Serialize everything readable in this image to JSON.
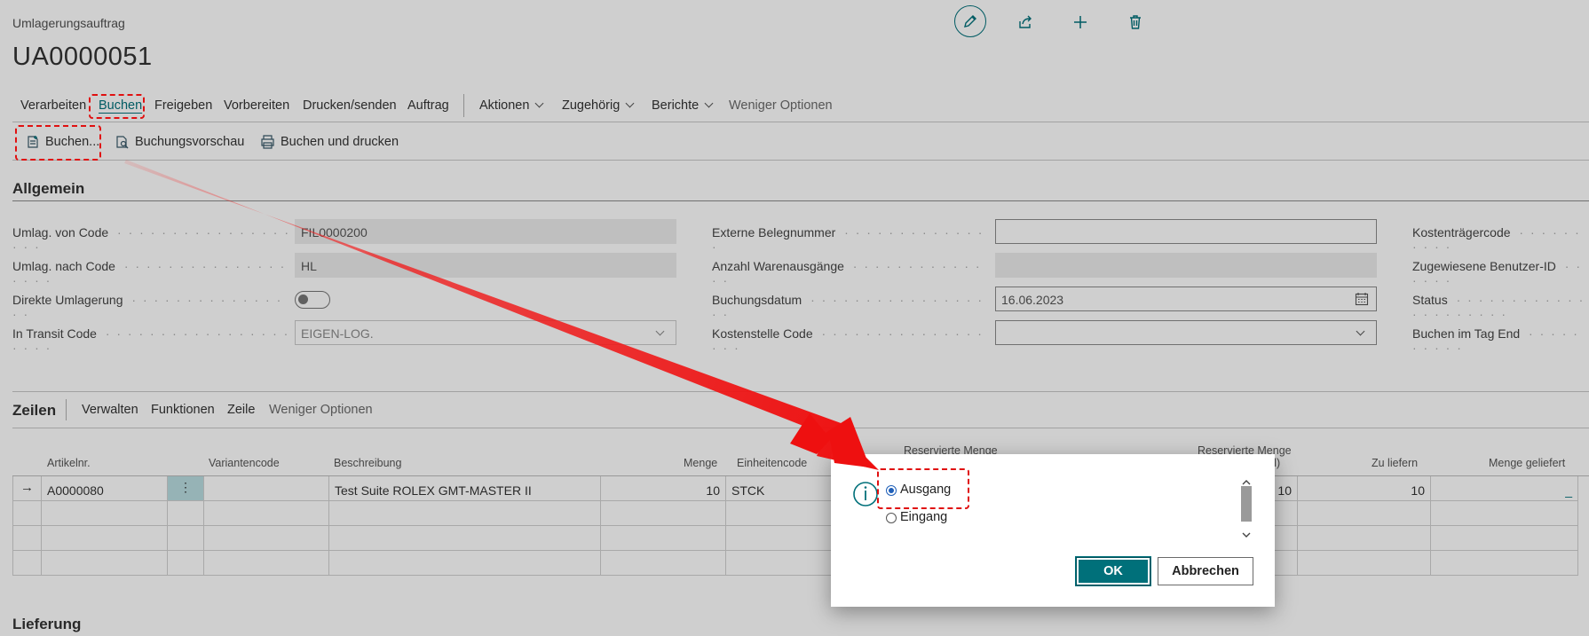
{
  "header": {
    "breadcrumb": "Umlagerungsauftrag",
    "record_title": "UA0000051",
    "icons": [
      "pencil-icon",
      "share-icon",
      "plus-icon",
      "trash-icon"
    ]
  },
  "action_bar": {
    "tabs": [
      "Verarbeiten",
      "Buchen",
      "Freigeben",
      "Vorbereiten",
      "Drucken/senden",
      "Auftrag"
    ],
    "menus": [
      "Aktionen",
      "Zugehörig",
      "Berichte"
    ],
    "fewer_options": "Weniger Optionen",
    "selected_tab": "Buchen"
  },
  "sub_actions": {
    "post": "Buchen...",
    "preview": "Buchungsvorschau",
    "post_print": "Buchen und drucken"
  },
  "general": {
    "title": "Allgemein",
    "from_code_label": "Umlag. von Code",
    "from_code_value": "FIL0000200",
    "to_code_label": "Umlag. nach Code",
    "to_code_value": "HL",
    "direct_label": "Direkte Umlagerung",
    "transit_label": "In Transit Code",
    "transit_value": "EIGEN-LOG.",
    "ext_doc_label": "Externe Belegnummer",
    "ext_doc_value": "",
    "shipments_label": "Anzahl Warenausgänge",
    "posting_date_label": "Buchungsdatum",
    "posting_date_value": "16.06.2023",
    "cost_center_label": "Kostenstelle Code",
    "cost_unit_label": "Kostenträgercode",
    "assigned_user_label": "Zugewiesene Benutzer-ID",
    "status_label": "Status",
    "post_eod_label": "Buchen im Tag End"
  },
  "lines": {
    "title": "Zeilen",
    "tabs": [
      "Verwalten",
      "Funktionen",
      "Zeile"
    ],
    "fewer_options": "Weniger Optionen",
    "columns": {
      "item": "Artikelnr.",
      "variant": "Variantencode",
      "desc": "Beschreibung",
      "qty": "Menge",
      "unit": "Einheitencode",
      "reserved1": "Reservierte Menge",
      "reserved2": "Reservierte Menge",
      "reserved2_tail": "d)",
      "to_ship": "Zu liefern",
      "shipped": "Menge geliefert"
    },
    "row": {
      "item": "A0000080",
      "desc": "Test Suite ROLEX GMT-MASTER II",
      "qty": "10",
      "unit": "STCK",
      "reserved_tail": "10",
      "to_ship": "10",
      "shipped": "_"
    }
  },
  "delivery": {
    "title": "Lieferung"
  },
  "dialog": {
    "options": [
      "Ausgang",
      "Eingang"
    ],
    "selected": "Ausgang",
    "ok": "OK",
    "cancel": "Abbrechen"
  },
  "colors": {
    "accent": "#00707a",
    "annotation": "#e01010"
  }
}
